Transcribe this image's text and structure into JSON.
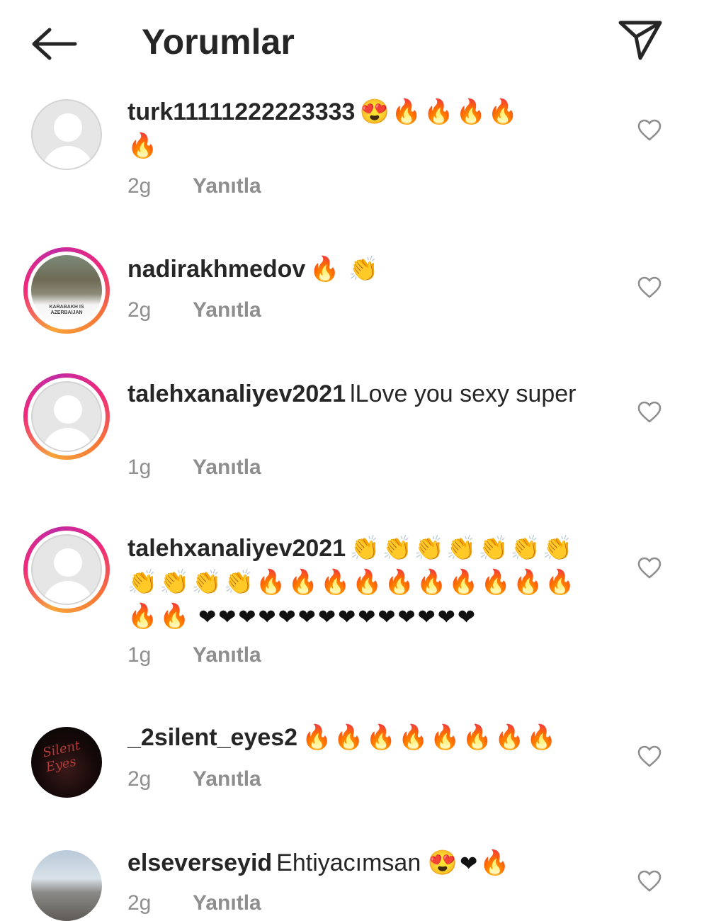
{
  "header": {
    "title": "Yorumlar"
  },
  "comments": [
    {
      "username": "turk11111222223333",
      "text": "",
      "emoji_face": "😍",
      "emoji_fire_line1": "🔥🔥🔥🔥",
      "emoji_fire_line2": "🔥",
      "time": "2g",
      "reply": "Yanıtla"
    },
    {
      "username": "nadirakhmedov",
      "text": "",
      "emoji_fire": "🔥",
      "emoji_clap": "👏",
      "avatar_caption": "KARABAKH IS AZERBAIJAN",
      "time": "2g",
      "reply": "Yanıtla"
    },
    {
      "username": "talehxanaliyev2021",
      "text": "lLove you sexy super",
      "time": "1g",
      "reply": "Yanıtla"
    },
    {
      "username": "talehxanaliyev2021",
      "emoji_clap_line1": "👏👏👏👏👏👏👏",
      "emoji_clap_line2": "👏👏👏👏",
      "emoji_fire_line2": "🔥🔥🔥🔥🔥🔥🔥🔥🔥🔥",
      "emoji_fire_line3": "🔥🔥",
      "emoji_hearts": "❤❤❤❤❤❤❤❤❤❤❤❤❤❤",
      "time": "1g",
      "reply": "Yanıtla"
    },
    {
      "username": "_2silent_eyes2",
      "emoji_fire": "🔥🔥🔥🔥🔥🔥🔥🔥",
      "avatar_caption": "Silent Eyes",
      "time": "2g",
      "reply": "Yanıtla"
    },
    {
      "username": "elseverseyid",
      "text": "Ehtiyacımsan",
      "emoji_face": "😍",
      "emoji_heart": "❤",
      "emoji_fire": "🔥",
      "time": "2g",
      "reply": "Yanıtla"
    }
  ],
  "icons": {
    "back": "arrow-left-icon",
    "send": "paper-plane-icon",
    "like": "heart-outline-icon"
  },
  "colors": {
    "story_ring_start": "#f9a43a",
    "story_ring_end": "#c32aa3",
    "meta_text": "#8e8e8e"
  }
}
